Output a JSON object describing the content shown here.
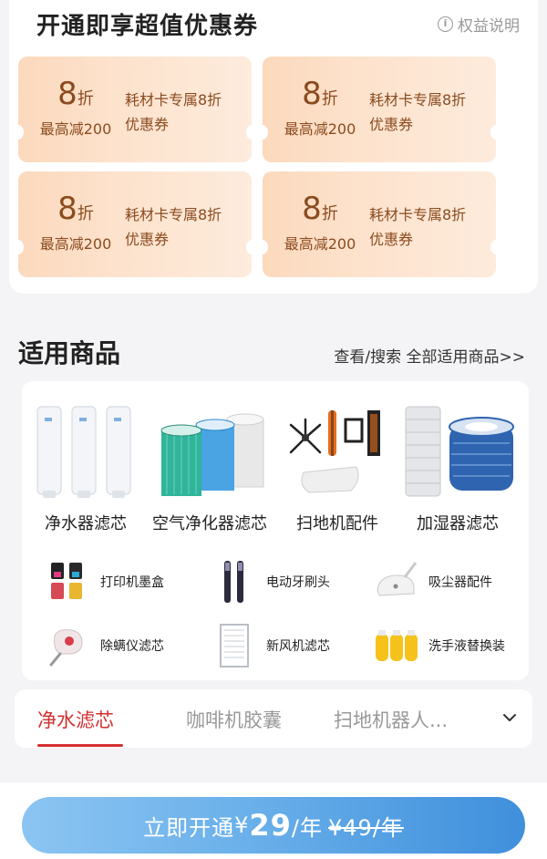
{
  "coupons": {
    "title": "开通即享超值优惠券",
    "info_label": "权益说明",
    "info_icon": "i",
    "items": [
      {
        "num": "8",
        "unit": "折",
        "max": "最高减200",
        "desc1": "耗材卡专属8折",
        "desc2": "优惠券"
      },
      {
        "num": "8",
        "unit": "折",
        "max": "最高减200",
        "desc1": "耗材卡专属8折",
        "desc2": "优惠券"
      },
      {
        "num": "8",
        "unit": "折",
        "max": "最高减200",
        "desc1": "耗材卡专属8折",
        "desc2": "优惠券"
      },
      {
        "num": "8",
        "unit": "折",
        "max": "最高减200",
        "desc1": "耗材卡专属8折",
        "desc2": "优惠券"
      }
    ]
  },
  "products": {
    "title": "适用商品",
    "see_all": "查看/搜索 全部适用商品>>",
    "big": [
      {
        "label": "净水器滤芯",
        "icon": "water-filter-icon"
      },
      {
        "label": "空气净化器滤芯",
        "icon": "air-filter-icon"
      },
      {
        "label": "扫地机配件",
        "icon": "robot-parts-icon"
      },
      {
        "label": "加湿器滤芯",
        "icon": "humidifier-filter-icon"
      }
    ],
    "small": [
      {
        "label": "打印机墨盒",
        "icon": "ink-cartridge-icon"
      },
      {
        "label": "电动牙刷头",
        "icon": "toothbrush-head-icon"
      },
      {
        "label": "吸尘器配件",
        "icon": "vacuum-parts-icon"
      },
      {
        "label": "除螨仪滤芯",
        "icon": "mite-filter-icon"
      },
      {
        "label": "新风机滤芯",
        "icon": "fresh-air-filter-icon"
      },
      {
        "label": "洗手液替换装",
        "icon": "hand-soap-refill-icon"
      }
    ]
  },
  "tabs": {
    "items": [
      "净水滤芯",
      "咖啡机胶囊",
      "扫地机器人..."
    ],
    "active_index": 0
  },
  "cta": {
    "prefix": "立即开通",
    "currency": "¥",
    "price": "29",
    "per": "/年",
    "old_price": "¥49/年"
  },
  "colors": {
    "accent_red": "#d32f2f",
    "coupon_text": "#8b4b1f",
    "cta_start": "#8cc5f2",
    "cta_end": "#3f8fdc"
  }
}
